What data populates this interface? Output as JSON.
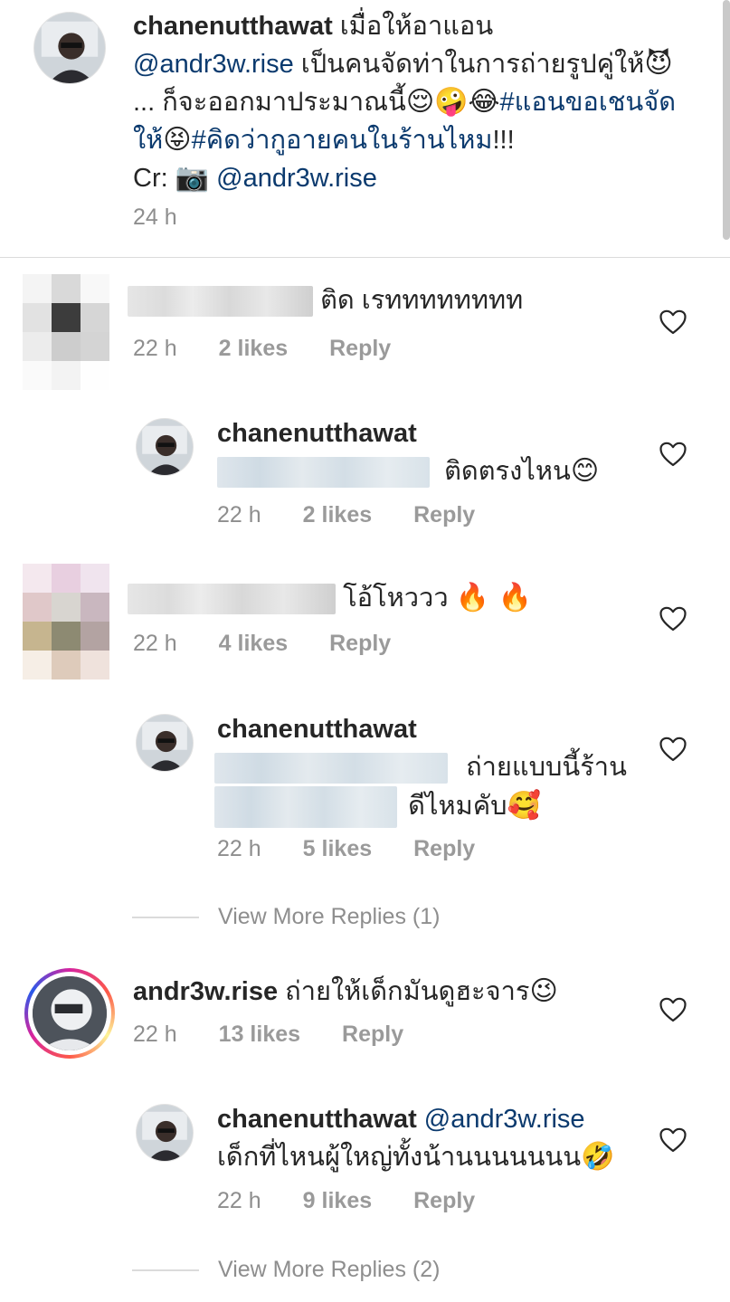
{
  "caption": {
    "username": "chanenutthawat",
    "text_1": " เมื่อให้อาแอน ",
    "mention_1": "@andr3w.rise",
    "text_2": " เป็นคนจัดท่าในการถ่ายรูปคู่ให้",
    "emoji_1": "😈",
    "text_3": "... ก็จะออกมาประมาณนี้",
    "emoji_2": "😌🤪😂",
    "hashtag_1": "#แอนขอเชนจัดให้",
    "emoji_3": "😝",
    "hashtag_2": "#คิดว่ากูอายคนในร้านไหม",
    "text_4": "!!!",
    "text_5": "Cr: ",
    "emoji_4": "📷",
    "mention_2": " @andr3w.rise",
    "time": "24 h"
  },
  "comments": [
    {
      "text": "ติด เรทททททททท",
      "time": "22 h",
      "likes": "2 likes",
      "reply": "Reply"
    },
    {
      "username": "chanenutthawat",
      "text": "ติดตรงไหน",
      "emoji": "😊",
      "time": "22 h",
      "likes": "2 likes",
      "reply": "Reply"
    },
    {
      "text": "โอ้โหววว ",
      "emoji": "🔥 🔥",
      "time": "22 h",
      "likes": "4 likes",
      "reply": "Reply"
    },
    {
      "username": "chanenutthawat",
      "text_line1": "ถ่ายแบบนี้ร้าน",
      "text_line2": "ดีไหมคับ",
      "emoji": "🥰",
      "time": "22 h",
      "likes": "5 likes",
      "reply": "Reply"
    },
    {
      "username": "andr3w.rise",
      "text": " ถ่ายให้เด็กมันดูฮะจาร",
      "emoji": "😉",
      "time": "22 h",
      "likes": "13 likes",
      "reply": "Reply"
    },
    {
      "username": "chanenutthawat",
      "mention": " @andr3w.rise",
      "text": "เด็กที่ไหนผู้ใหญ่ทั้งน้านนนนนนน",
      "emoji": "🤣",
      "time": "22 h",
      "likes": "9 likes",
      "reply": "Reply"
    }
  ],
  "view_more_1": "View More Replies (1)",
  "view_more_2": "View More Replies (2)",
  "colors": {
    "mention": "#0b3a6e",
    "meta_gray": "#8e8e8e",
    "divider": "#dbdbdb"
  },
  "icons": {
    "like": "heart-outline-icon"
  }
}
